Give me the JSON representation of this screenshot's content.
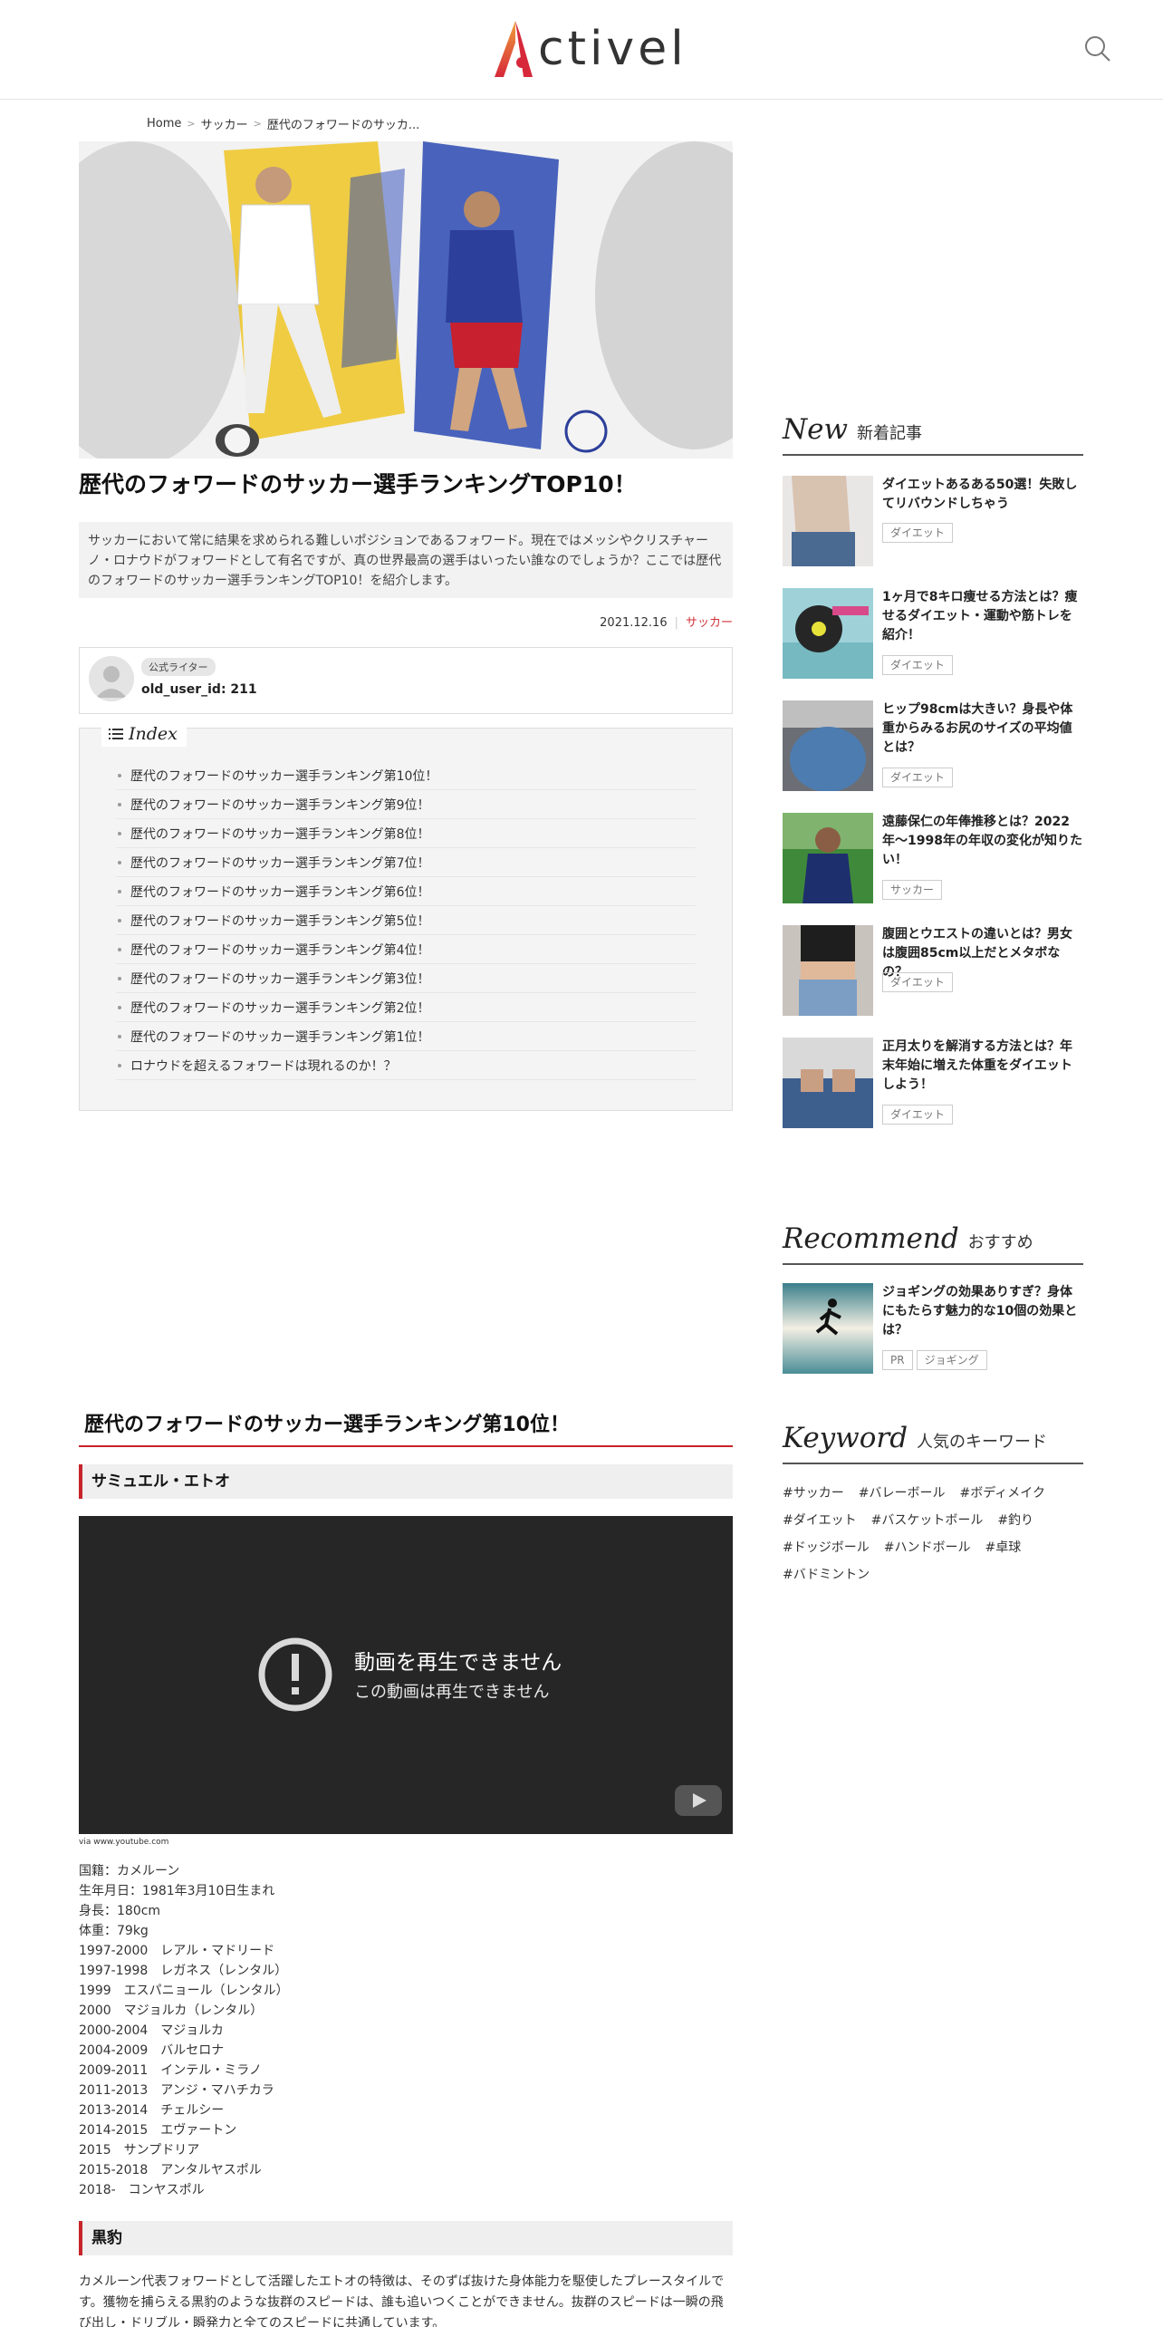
{
  "header": {
    "logo_text": "ctivel",
    "logo_alt": "Activel",
    "search_icon": "search-icon"
  },
  "breadcrumb": {
    "home": "Home",
    "category": "サッカー",
    "current": "歴代のフォワードのサッカ..."
  },
  "article": {
    "title": "歴代のフォワードのサッカー選手ランキングTOP10！",
    "lead": "サッカーにおいて常に結果を求められる難しいポジションであるフォワード。現在ではメッシやクリスチャーノ・ロナウドがフォワードとして有名ですが、真の世界最高の選手はいったい誰なのでしょうか？ここでは歴代のフォワードのサッカー選手ランキングTOP10！を紹介します。",
    "date": "2021.12.16",
    "category": "サッカー",
    "author_badge": "公式ライター",
    "author_name": "old_user_id: 211"
  },
  "index": {
    "title": "Index",
    "items": [
      "歴代のフォワードのサッカー選手ランキング第10位！",
      "歴代のフォワードのサッカー選手ランキング第9位！",
      "歴代のフォワードのサッカー選手ランキング第8位！",
      "歴代のフォワードのサッカー選手ランキング第7位！",
      "歴代のフォワードのサッカー選手ランキング第6位！",
      "歴代のフォワードのサッカー選手ランキング第5位！",
      "歴代のフォワードのサッカー選手ランキング第4位！",
      "歴代のフォワードのサッカー選手ランキング第3位！",
      "歴代のフォワードのサッカー選手ランキング第2位！",
      "歴代のフォワードのサッカー選手ランキング第1位！",
      "ロナウドを超えるフォワードは現れるのか！？"
    ]
  },
  "section": {
    "h2": "歴代のフォワードのサッカー選手ランキング第10位！",
    "h3_name": "サミュエル・エトオ",
    "video_error_title": "動画を再生できません",
    "video_error_sub": "この動画は再生できません",
    "via": "via www.youtube.com",
    "profile": [
      "国籍：カメルーン",
      "生年月日：1981年3月10日生まれ",
      "身長：180cm",
      "体重：79kg",
      "1997-2000　レアル・マドリード",
      "1997-1998　レガネス（レンタル）",
      "1999　エスパニョール（レンタル）",
      "2000　マジョルカ（レンタル）",
      "2000-2004　マジョルカ",
      "2004-2009　バルセロナ",
      "2009-2011　インテル・ミラノ",
      "2011-2013　アンジ・マハチカラ",
      "2013-2014　チェルシー",
      "2014-2015　エヴァートン",
      "2015　サンプドリア",
      "2015-2018　アンタルヤスポル",
      "2018-　コンヤスポル"
    ],
    "h3_panther": "黒豹",
    "body": "カメルーン代表フォワードとして活躍したエトオの特徴は、そのずば抜けた身体能力を駆使したプレースタイルです。獲物を捕らえる黒豹のような抜群のスピードは、誰も追いつくことができません。抜群のスピードは一瞬の飛び出し・ドリブル・瞬発力と全てのスピードに共通しています。"
  },
  "sidebar": {
    "new": {
      "en": "New",
      "jp": "新着記事"
    },
    "new_items": [
      {
        "title": "ダイエットあるある50選！失敗してリバウンドしちゃう",
        "tag": "ダイエット"
      },
      {
        "title": "1ヶ月で8キロ痩せる方法とは？痩せるダイエット・運動や筋トレを紹介！",
        "tag": "ダイエット"
      },
      {
        "title": "ヒップ98cmは大きい？身長や体重からみるお尻のサイズの平均値とは？",
        "tag": "ダイエット"
      },
      {
        "title": "遠藤保仁の年俸推移とは？2022年〜1998年の年収の変化が知りたい！",
        "tag": "サッカー"
      },
      {
        "title": "腹囲とウエストの違いとは？男女は腹囲85cm以上だとメタボなの？",
        "tag": "ダイエット"
      },
      {
        "title": "正月太りを解消する方法とは？年末年始に増えた体重をダイエットしよう！",
        "tag": "ダイエット"
      }
    ],
    "recommend": {
      "en": "Recommend",
      "jp": "おすすめ"
    },
    "recommend_item": {
      "title": "ジョギングの効果ありすぎ？身体にもたらす魅力的な10個の効果とは？",
      "tag1": "PR",
      "tag2": "ジョギング"
    },
    "keyword": {
      "en": "Keyword",
      "jp": "人気のキーワード"
    },
    "keywords": [
      "#サッカー",
      "#バレーボール",
      "#ボディメイク",
      "#ダイエット",
      "#バスケットボール",
      "#釣り",
      "#ドッジボール",
      "#ハンドボール",
      "#卓球",
      "#バドミントン"
    ]
  }
}
